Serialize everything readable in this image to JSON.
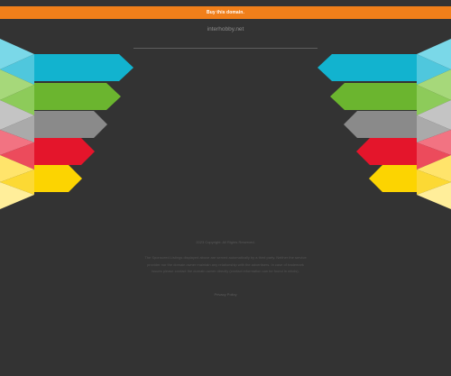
{
  "banner": {
    "buy_link": "Buy this domain.",
    "color": "#f07f1a"
  },
  "domain": {
    "name": "interhobby.net"
  },
  "colors": {
    "background": "#333333",
    "cyan": "#12b3cf",
    "green": "#6bb52f",
    "gray": "#8a8a8a",
    "red": "#e4152b",
    "yellow": "#fcd401"
  },
  "footer": {
    "heading": "2023 Copyright. All Rights Reserved.",
    "body": "The Sponsored Listings displayed above are served automatically by a third party. Neither the service provider nor the domain owner maintain any relationship with the advertisers. In case of trademark issues please contact the domain owner directly (contact information can be found in whois).",
    "privacy_link": "Privacy Policy"
  }
}
